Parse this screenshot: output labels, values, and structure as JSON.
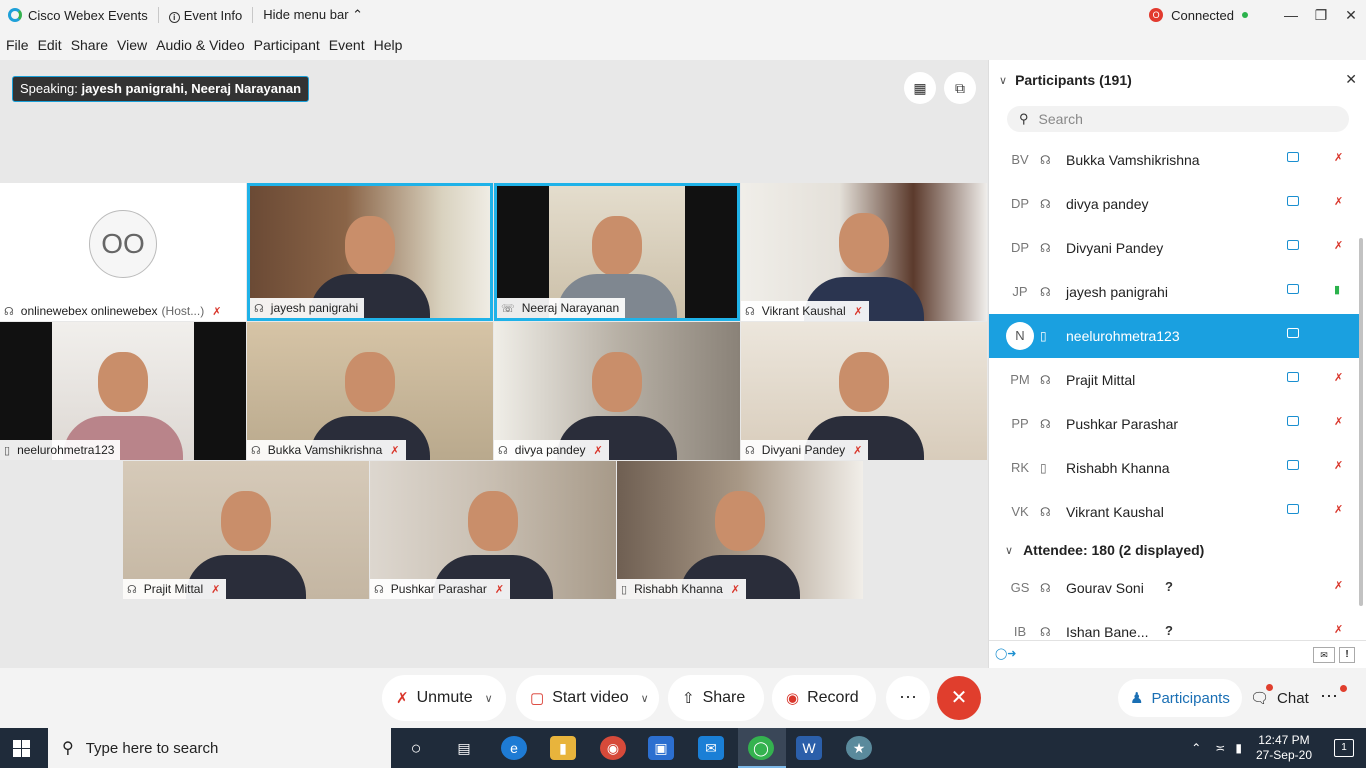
{
  "titlebar": {
    "app_name": "Cisco Webex Events",
    "event_info": "Event Info",
    "hide_menu": "Hide menu bar",
    "status": "Connected",
    "status_badge": "O"
  },
  "menu": [
    "File",
    "Edit",
    "Share",
    "View",
    "Audio & Video",
    "Participant",
    "Event",
    "Help"
  ],
  "stage": {
    "speaking_label": "Speaking:",
    "speaking_names": "jayesh panigrahi, Neeraj Narayanan"
  },
  "tiles": [
    {
      "name": "onlinewebex onlinewebex",
      "extra": "(Host...)",
      "avatar": "OO"
    },
    {
      "name": "jayesh panigrahi"
    },
    {
      "name": "Neeraj Narayanan"
    },
    {
      "name": "Vikrant Kaushal"
    },
    {
      "name": "neelurohmetra123"
    },
    {
      "name": "Bukka Vamshikrishna"
    },
    {
      "name": "divya pandey"
    },
    {
      "name": "Divyani Pandey"
    },
    {
      "name": "Prajit Mittal"
    },
    {
      "name": "Pushkar Parashar"
    },
    {
      "name": "Rishabh Khanna"
    }
  ],
  "controls": {
    "unmute": "Unmute",
    "start_video": "Start video",
    "share": "Share",
    "record": "Record",
    "more": "···",
    "participants": "Participants",
    "chat": "Chat"
  },
  "panel": {
    "title": "Participants (191)",
    "search_placeholder": "Search",
    "panelists": [
      {
        "initials": "BV",
        "name": "Bukka Vamshikrishna"
      },
      {
        "initials": "DP",
        "name": "divya pandey"
      },
      {
        "initials": "DP",
        "name": "Divyani Pandey"
      },
      {
        "initials": "JP",
        "name": "jayesh panigrahi"
      },
      {
        "initials": "N",
        "name": "neelurohmetra123"
      },
      {
        "initials": "PM",
        "name": "Prajit Mittal"
      },
      {
        "initials": "PP",
        "name": "Pushkar Parashar"
      },
      {
        "initials": "RK",
        "name": "Rishabh Khanna"
      },
      {
        "initials": "VK",
        "name": "Vikrant Kaushal"
      }
    ],
    "attendee_header": "Attendee: 180 (2 displayed)",
    "attendees": [
      {
        "initials": "GS",
        "name": "Gourav Soni",
        "status": "?"
      },
      {
        "initials": "IB",
        "name": "Ishan Bane...",
        "status": "?"
      }
    ]
  },
  "taskbar": {
    "search_placeholder": "Type here to search",
    "time": "12:47 PM",
    "date": "27-Sep-20",
    "notifications": "1"
  }
}
